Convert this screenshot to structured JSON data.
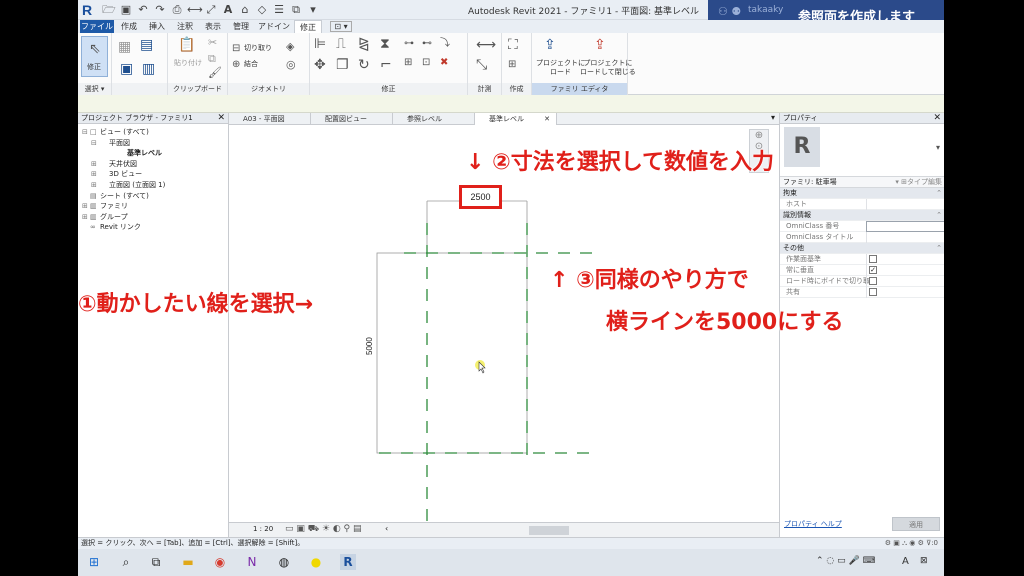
{
  "window": {
    "title": "Autodesk Revit 2021 - ファミリ1 - 平面図: 基準レベル",
    "user_name": "takaaky",
    "tutorial_hint": "参照面を作成します"
  },
  "ribbon_tabs": [
    "ファイル",
    "作成",
    "挿入",
    "注釈",
    "表示",
    "管理",
    "アドイン",
    "修正"
  ],
  "ribbon": {
    "modify_label": "修正",
    "select_group": "選択 ▾",
    "clipboard_group": "クリップボード",
    "paste_label": "貼り付け",
    "geometry_group": "ジオメトリ",
    "cut_label": "切り取り",
    "join_label": "結合",
    "modify_group": "修正",
    "measure_group": "計測",
    "create_group": "作成",
    "family_editor_group": "ファミリ エディタ",
    "load_into_project": "プロジェクトに\nロード",
    "load_and_close": "プロジェクトに\nロードして閉じる"
  },
  "project_browser": {
    "title": "プロジェクト ブラウザ - ファミリ1",
    "items": [
      {
        "toggle": "⊟",
        "icon": "□",
        "label": "ビュー (すべて)",
        "indent": 0
      },
      {
        "toggle": "⊟",
        "icon": "",
        "label": "平面図",
        "indent": 1
      },
      {
        "toggle": "",
        "icon": "",
        "label": "基準レベル",
        "indent": 3,
        "selected": true
      },
      {
        "toggle": "⊞",
        "icon": "",
        "label": "天井伏図",
        "indent": 1
      },
      {
        "toggle": "⊞",
        "icon": "",
        "label": "3D ビュー",
        "indent": 1
      },
      {
        "toggle": "⊞",
        "icon": "",
        "label": "立面図 (立面図 1)",
        "indent": 1
      },
      {
        "toggle": "",
        "icon": "▤",
        "label": "シート (すべて)",
        "indent": 0
      },
      {
        "toggle": "⊞",
        "icon": "▥",
        "label": "ファミリ",
        "indent": 0
      },
      {
        "toggle": "⊞",
        "icon": "▥",
        "label": "グループ",
        "indent": 0
      },
      {
        "toggle": "",
        "icon": "∞",
        "label": "Revit リンク",
        "indent": 0
      }
    ]
  },
  "view_tabs": [
    "A03 - 平面図",
    "配置図ビュー",
    "参照レベル",
    "基準レベル"
  ],
  "canvas": {
    "dim_top": "2500",
    "dim_left": "5000",
    "scale": "1 : 20"
  },
  "annotations": {
    "step1": "①動かしたい線を選択→",
    "step2": "↓ ②寸法を選択して数値を入力",
    "step3_line1": "↑ ③同様のやり方で",
    "step3_line2": "横ラインを5000にする"
  },
  "properties": {
    "title": "プロパティ",
    "family_type": "ファミリ: 駐車場",
    "edit_type": "タイプ編集",
    "rows": [
      {
        "kind": "cat",
        "label": "拘束"
      },
      {
        "kind": "val",
        "label": "ホスト",
        "value": ""
      },
      {
        "kind": "cat",
        "label": "識別情報"
      },
      {
        "kind": "input",
        "label": "OmniClass 番号",
        "value": ""
      },
      {
        "kind": "val",
        "label": "OmniClass タイトル",
        "value": ""
      },
      {
        "kind": "cat",
        "label": "その他"
      },
      {
        "kind": "check",
        "label": "作業面基準",
        "checked": false
      },
      {
        "kind": "check",
        "label": "常に垂直",
        "checked": true
      },
      {
        "kind": "check",
        "label": "ロード時にボイドで切り取り",
        "checked": false
      },
      {
        "kind": "check",
        "label": "共有",
        "checked": false
      }
    ],
    "help_link": "プロパティ ヘルプ",
    "apply": "適用"
  },
  "status_bar": {
    "text": "選択 = クリック、次へ = [Tab]、追加 = [Ctrl]、選択解除 = [Shift]。",
    "right": ":0"
  },
  "taskbar": {
    "tray_lang": "A"
  }
}
